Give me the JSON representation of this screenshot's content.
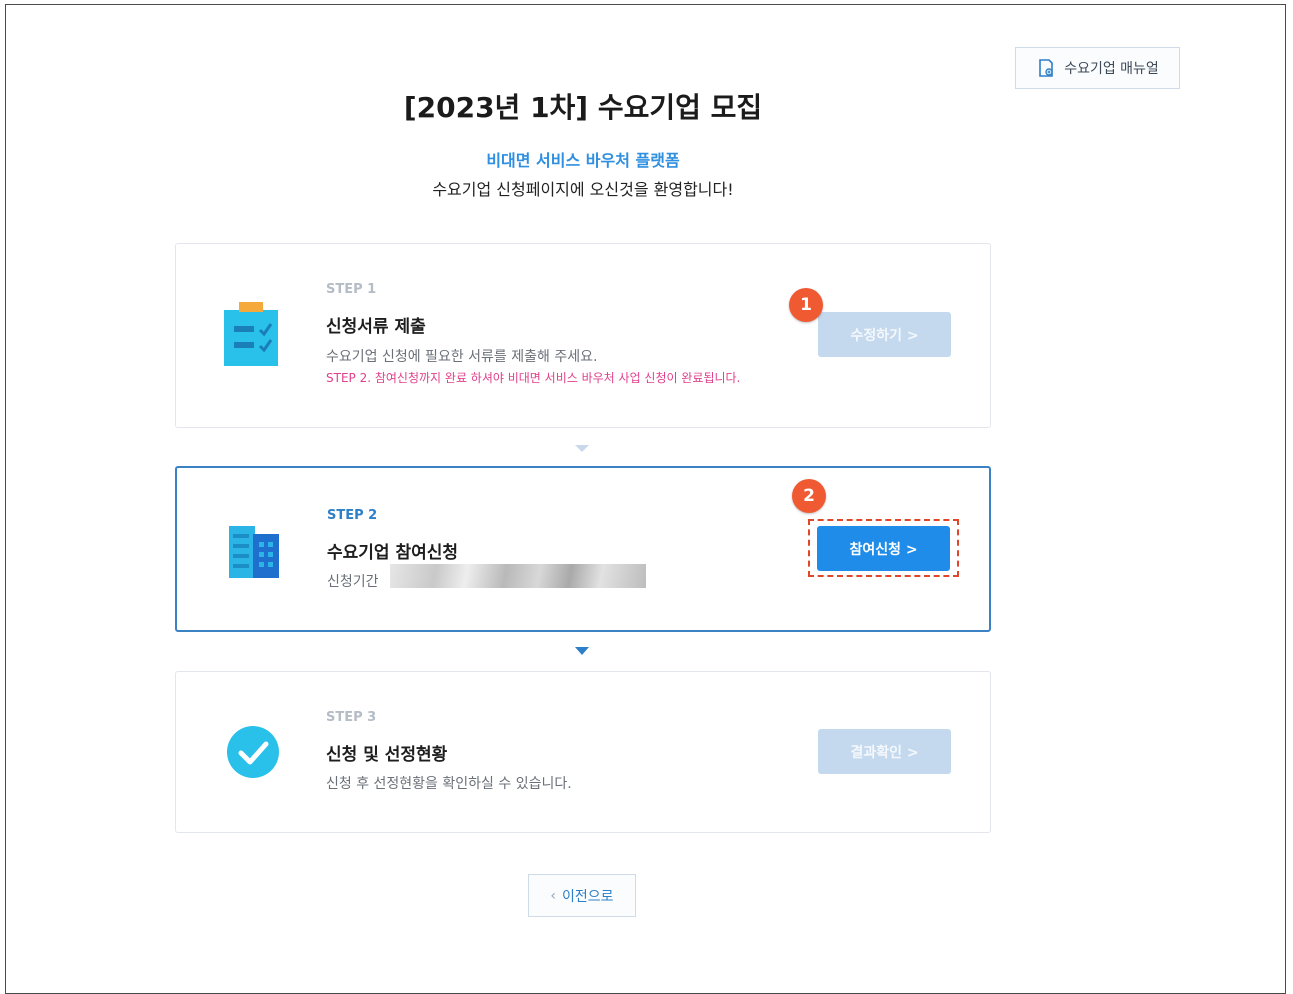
{
  "header": {
    "manual_button": "수요기업 매뉴얼",
    "title": "[2023년 1차] 수요기업 모집",
    "subtitle_highlight": "비대면 서비스 바우처 플랫폼",
    "subtitle": "수요기업 신청페이지에 오신것을 환영합니다!"
  },
  "steps": [
    {
      "label": "STEP 1",
      "title": "신청서류 제출",
      "description": "수요기업 신청에 필요한 서류를 제출해 주세요.",
      "note": "STEP 2. 참여신청까지 완료 하셔야 비대면 서비스 바우처 사업 신청이 완료됩니다.",
      "button": "수정하기 >",
      "button_state": "disabled",
      "badge": "1",
      "icon": "clipboard-icon"
    },
    {
      "label": "STEP 2",
      "title": "수요기업 참여신청",
      "description": "신청기간",
      "button": "참여신청 >",
      "button_state": "enabled",
      "badge": "2",
      "icon": "building-icon"
    },
    {
      "label": "STEP 3",
      "title": "신청 및 선정현황",
      "description": "신청 후 선정현황을 확인하실 수 있습니다.",
      "button": "결과확인 >",
      "button_state": "disabled",
      "icon": "check-circle-icon"
    }
  ],
  "footer": {
    "prev_button": "이전으로"
  },
  "colors": {
    "accent": "#1e8ce8",
    "active_border": "#3b82c4",
    "disabled_button": "#c4d9ee",
    "badge": "#ef5a33",
    "note": "#e0418c"
  }
}
